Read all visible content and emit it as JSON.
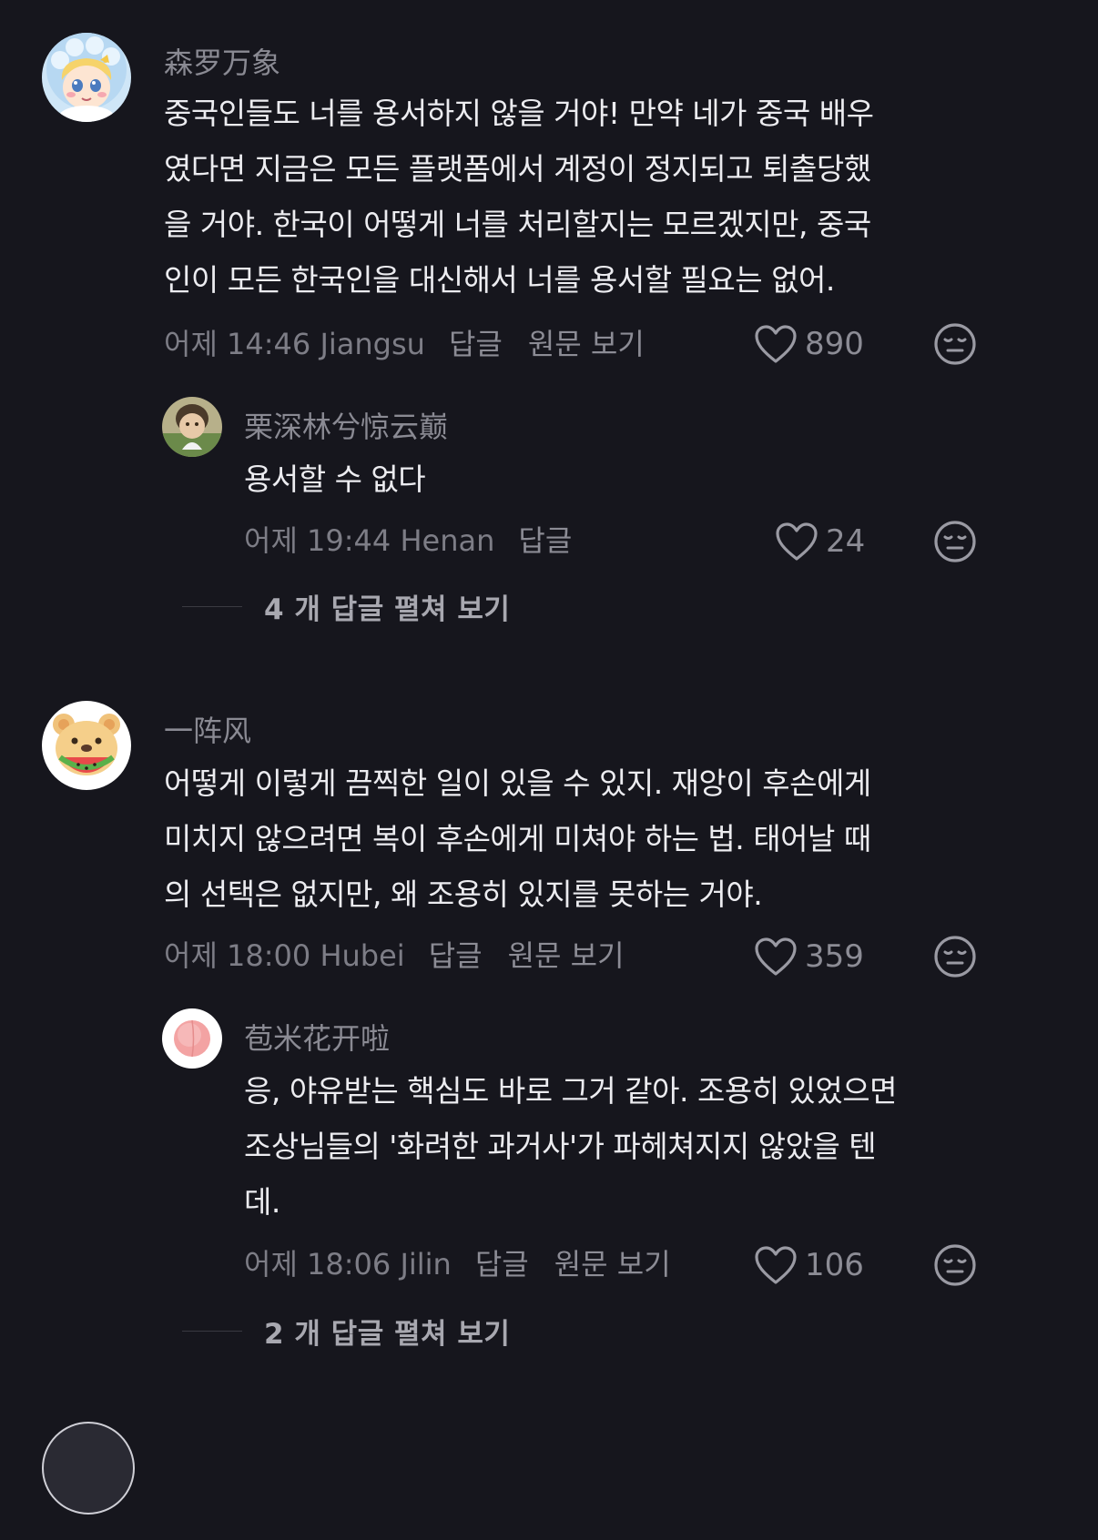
{
  "comments": [
    {
      "username": "森罗万象",
      "lines": [
        "중국인들도 너를 용서하지 않을 거야! 만약 네가 중국 배우",
        "였다면 지금은 모든 플랫폼에서 계정이 정지되고 퇴출당했",
        "을 거야. 한국이 어떻게 너를 처리할지는 모르겠지만, 중국",
        "인이 모든 한국인을 대신해서 너를 용서할 필요는 없어."
      ],
      "time_location": "어제 14:46 Jiangsu",
      "reply_label": "답글",
      "view_original_label": "원문 보기",
      "likes": "890",
      "replies": [
        {
          "username": "栗深林兮惊云巅",
          "text": "용서할 수 없다",
          "time_location": "어제 19:44 Henan",
          "reply_label": "답글",
          "likes": "24"
        }
      ],
      "expand_label": "4 개 답글 펼쳐 보기"
    },
    {
      "username": "一阵风",
      "lines": [
        "어떻게 이렇게 끔찍한 일이 있을 수 있지. 재앙이 후손에게",
        "미치지 않으려면 복이 후손에게 미쳐야 하는 법. 태어날 때",
        "의 선택은 없지만, 왜 조용히 있지를 못하는 거야."
      ],
      "time_location": "어제 18:00 Hubei",
      "reply_label": "답글",
      "view_original_label": "원문 보기",
      "likes": "359",
      "replies": [
        {
          "username": "苞米花开啦",
          "lines": [
            "응, 야유받는 핵심도 바로 그거 같아. 조용히 있었으면",
            "조상님들의 '화려한 과거사'가 파헤쳐지지 않았을 텐",
            "데."
          ],
          "time_location": "어제 18:06 Jilin",
          "reply_label": "답글",
          "view_original_label": "원문 보기",
          "likes": "106"
        }
      ],
      "expand_label": "2 개 답글 펼쳐 보기"
    }
  ],
  "colors": {
    "background": "#16161d",
    "text": "#ececf0",
    "muted": "#7d7d86"
  },
  "icons": [
    "heart-icon",
    "meh-face-icon"
  ]
}
